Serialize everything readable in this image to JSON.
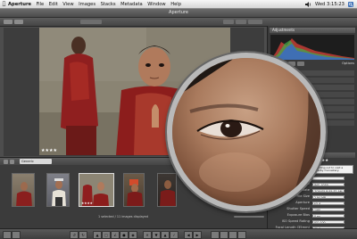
{
  "menubar": {
    "apple": "",
    "items": [
      "Aperture",
      "File",
      "Edit",
      "View",
      "Images",
      "Stacks",
      "Metadata",
      "Window",
      "Help"
    ],
    "clock": "Wed 3:15:23"
  },
  "window": {
    "title": "Aperture"
  },
  "viewer": {
    "rating": "★★★★"
  },
  "browser": {
    "dropdown": "Generic",
    "status": "1 selected / 11 images displayed"
  },
  "inspector": {
    "adjustments_title": "Adjustments",
    "options_label": "Options",
    "metadata_rating": "★★★★",
    "caption": "Heading out to visit a nearby monastery.",
    "fields": [
      {
        "label": "Caption",
        "value": ""
      },
      {
        "label": "Keywords",
        "value": ""
      },
      {
        "label": "Version Name",
        "value": "IMG_0255"
      },
      {
        "label": "Image Date",
        "value": "7/20/05 8:55:32 AM"
      },
      {
        "label": "File Size",
        "value": "2.94 MB"
      },
      {
        "label": "Aperture",
        "value": "f/5.6"
      },
      {
        "label": "Shutter Speed",
        "value": "1/60"
      },
      {
        "label": "Exposure Bias",
        "value": "0 ev"
      },
      {
        "label": "ISO Speed Rating",
        "value": "ISO 100"
      },
      {
        "label": "Focal Length (35mm)",
        "value": "75.0mm"
      },
      {
        "label": "Focal Length",
        "value": "75.0mm"
      }
    ],
    "tabs": [
      "General",
      "EXIF",
      "IPTC",
      "Other",
      "Archive"
    ]
  },
  "colors": {
    "accent": "#3d6fb6",
    "histogram_red": "#d9413a",
    "histogram_green": "#3fb04a",
    "histogram_blue": "#3466d9"
  }
}
